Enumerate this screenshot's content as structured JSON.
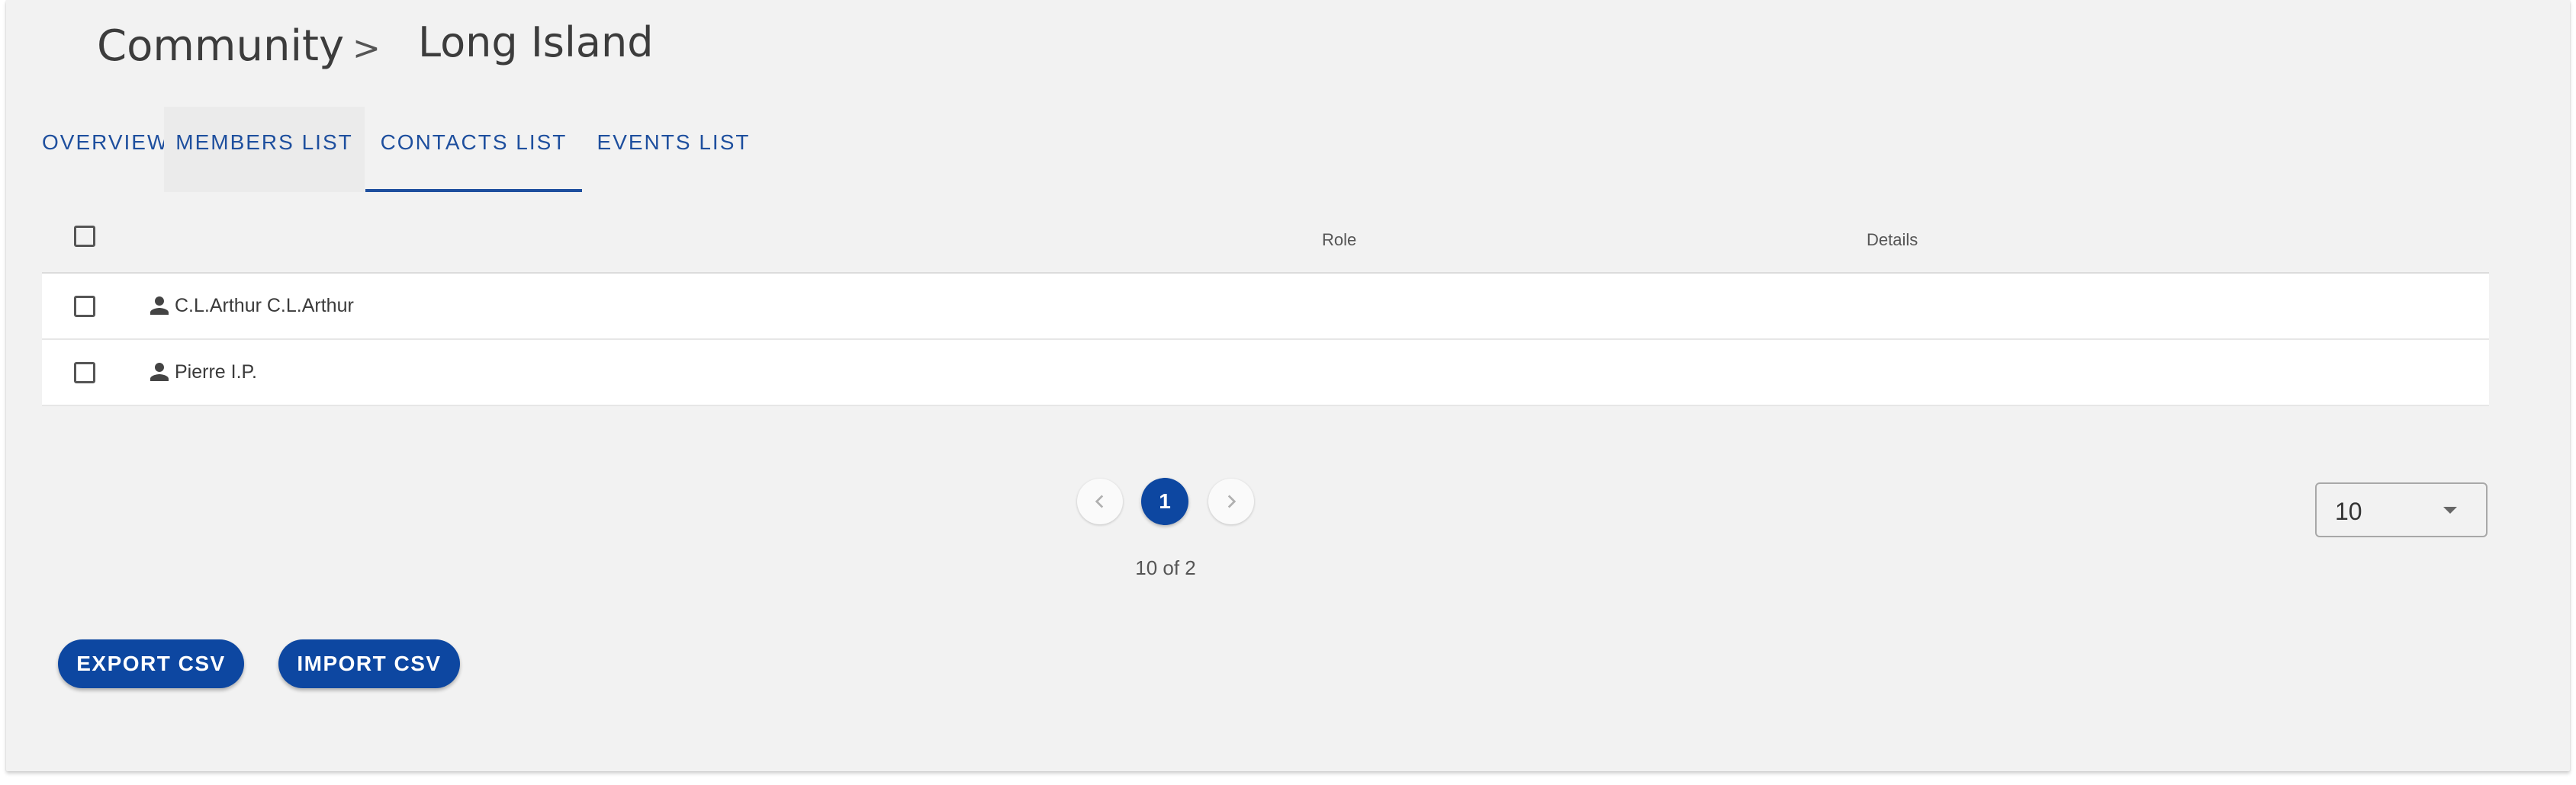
{
  "breadcrumb": {
    "root": "Community",
    "separator": ">",
    "current": "Long Island"
  },
  "tabs": [
    {
      "label": "OVERVIEW"
    },
    {
      "label": "MEMBERS LIST"
    },
    {
      "label": "CONTACTS LIST"
    },
    {
      "label": "EVENTS LIST"
    }
  ],
  "active_tab": "CONTACTS LIST",
  "table": {
    "headers": {
      "role": "Role",
      "details": "Details"
    },
    "rows": [
      {
        "name": "C.L.Arthur C.L.Arthur",
        "role": "",
        "details": "",
        "icon": "person-icon"
      },
      {
        "name": "Pierre I.P.",
        "role": "",
        "details": "",
        "icon": "person-icon"
      }
    ]
  },
  "pagination": {
    "current_page": "1",
    "info": "10 of 2",
    "page_size": "10"
  },
  "actions": {
    "export_label": "EXPORT CSV",
    "import_label": "IMPORT CSV"
  },
  "colors": {
    "primary": "#0d47a1",
    "tab_text": "#1e4f9e",
    "background": "#f2f2f2"
  }
}
